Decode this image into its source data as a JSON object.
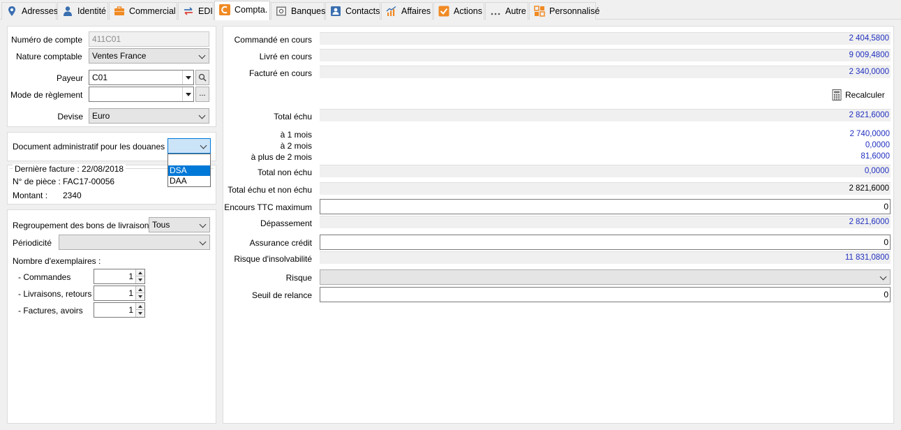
{
  "tabs": [
    {
      "label": "Adresses",
      "icon": "map-pin-icon"
    },
    {
      "label": "Identité",
      "icon": "person-icon"
    },
    {
      "label": "Commercial",
      "icon": "briefcase-icon"
    },
    {
      "label": "EDI",
      "icon": "exchange-arrows-icon"
    },
    {
      "label": "Compta.",
      "icon": "compta-c-icon"
    },
    {
      "label": "Banques",
      "icon": "safe-icon"
    },
    {
      "label": "Contacts",
      "icon": "contact-card-icon"
    },
    {
      "label": "Affaires",
      "icon": "chart-growth-icon"
    },
    {
      "label": "Actions",
      "icon": "checkbox-check-icon"
    },
    {
      "label": "Autre",
      "icon": "ellipsis-icon"
    },
    {
      "label": "Personnalisé",
      "icon": "custom-grid-icon"
    }
  ],
  "account": {
    "numero_label": "Numéro de compte",
    "numero_value": "411C01",
    "nature_label": "Nature comptable",
    "nature_value": "Ventes France",
    "payeur_label": "Payeur",
    "payeur_value": "C01",
    "mode_label": "Mode de règlement",
    "mode_value": "",
    "mode_button": "...",
    "devise_label": "Devise",
    "devise_value": "Euro"
  },
  "douane": {
    "label": "Document administratif pour les douanes",
    "value": "",
    "options": [
      "",
      "DSA",
      "DAA"
    ],
    "selected_option": "DSA"
  },
  "last_invoice": {
    "title": "Dernière facture : 22/08/2018",
    "piece_label": "N° de pièce :",
    "piece_value": "FAC17-00056",
    "montant_label": "Montant :",
    "montant_value": "2340"
  },
  "delivery": {
    "regroup_label": "Regroupement des bons de livraison",
    "regroup_value": "Tous",
    "periodicite_label": "Périodicité",
    "periodicite_value": "",
    "copies_label": "Nombre d'exemplaires :",
    "commandes_label": "- Commandes",
    "commandes_value": "1",
    "livraisons_label": "- Livraisons, retours",
    "livraisons_value": "1",
    "factures_label": "- Factures, avoirs",
    "factures_value": "1"
  },
  "finance": {
    "commande_label": "Commandé en cours",
    "commande_value": "2 404,5800",
    "livre_label": "Livré en cours",
    "livre_value": "9 009,4800",
    "facture_label": "Facturé en cours",
    "facture_value": "2 340,0000",
    "recalc_label": "Recalculer",
    "total_echu_label": "Total échu",
    "total_echu_value": "2 821,6000",
    "mois1_label": "à 1 mois",
    "mois1_value": "2 740,0000",
    "mois2_label": "à 2 mois",
    "mois2_value": "0,0000",
    "mois3_label": "à plus de 2 mois",
    "mois3_value": "81,6000",
    "non_echu_label": "Total non échu",
    "non_echu_value": "0,0000",
    "echu_non_echu_label": "Total échu et non échu",
    "echu_non_echu_value": "2 821,6000",
    "encours_label": "Encours TTC maximum",
    "encours_value": "0",
    "depassement_label": "Dépassement",
    "depassement_value": "2 821,6000",
    "assurance_label": "Assurance crédit",
    "assurance_value": "0",
    "risque_insolv_label": "Risque d'insolvabilité",
    "risque_insolv_value": "11 831,0800",
    "risque_label": "Risque",
    "risque_value": "",
    "seuil_label": "Seuil de relance",
    "seuil_value": "0"
  },
  "colors": {
    "accent_blue": "#1f2fbf",
    "selection_blue": "#0078d7",
    "compta_orange": "#f08a24"
  }
}
